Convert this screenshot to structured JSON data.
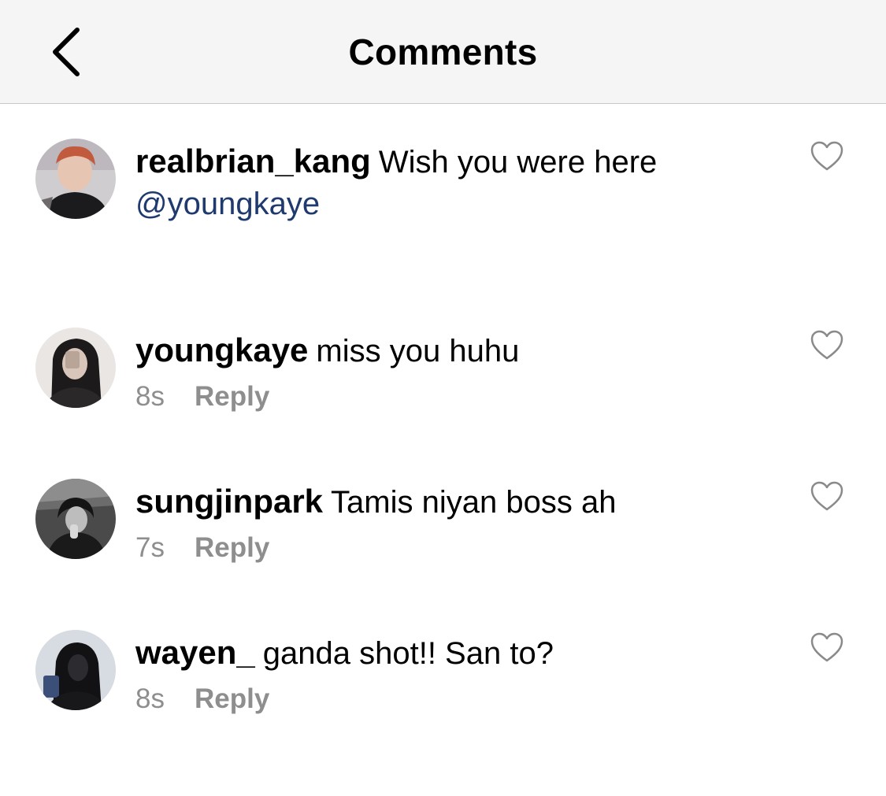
{
  "header": {
    "title": "Comments",
    "back_icon": "chevron-left-icon"
  },
  "caption": {
    "username": "realbrian_kang",
    "text": "Wish you were here",
    "mention": "@youngkaye",
    "avatar": "avatar-realbrian_kang",
    "like_icon": "heart-outline-icon"
  },
  "comments": [
    {
      "username": "youngkaye",
      "text": "miss you huhu",
      "time": "8s",
      "reply_label": "Reply",
      "avatar": "avatar-youngkaye",
      "like_icon": "heart-outline-icon"
    },
    {
      "username": "sungjinpark",
      "text": "Tamis niyan boss ah",
      "time": "7s",
      "reply_label": "Reply",
      "avatar": "avatar-sungjinpark",
      "like_icon": "heart-outline-icon"
    },
    {
      "username": "wayen_",
      "text": "ganda shot!! San to?",
      "time": "8s",
      "reply_label": "Reply",
      "avatar": "avatar-wayen_",
      "like_icon": "heart-outline-icon"
    }
  ],
  "colors": {
    "nav_background": "#f5f5f5",
    "mention": "#1e3a6e",
    "meta_text": "#8e8e8e"
  }
}
